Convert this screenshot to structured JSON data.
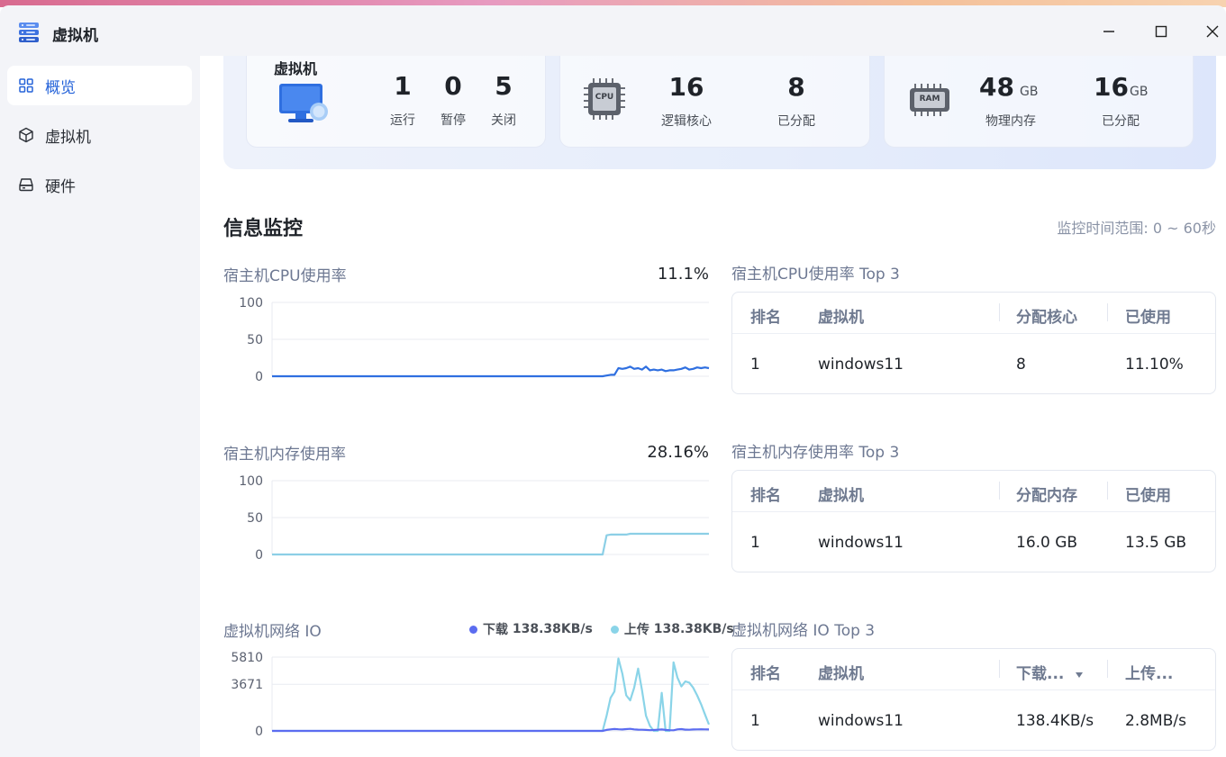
{
  "window": {
    "title": "虚拟机"
  },
  "sidebar": {
    "items": [
      {
        "label": "概览",
        "icon": "grid-icon",
        "active": true
      },
      {
        "label": "虚拟机",
        "icon": "cube-icon",
        "active": false
      },
      {
        "label": "硬件",
        "icon": "hard-drive-icon",
        "active": false
      }
    ]
  },
  "summary": {
    "vm_card": {
      "label": "虚拟机",
      "running": "1",
      "running_label": "运行",
      "paused": "0",
      "paused_label": "暂停",
      "stopped": "5",
      "stopped_label": "关闭"
    },
    "cpu_card": {
      "chip_text": "CPU",
      "logical_cores": "16",
      "logical_cores_label": "逻辑核心",
      "allocated": "8",
      "allocated_label": "已分配"
    },
    "ram_card": {
      "chip_text": "RAM",
      "physical": "48",
      "physical_unit": "GB",
      "physical_label": "物理内存",
      "allocated": "16",
      "allocated_unit": "GB",
      "allocated_label": "已分配"
    }
  },
  "monitor": {
    "title": "信息监控",
    "range": "监控时间范围: 0 ~ 60秒",
    "cpu": {
      "title": "宿主机CPU使用率",
      "value": "11.1%"
    },
    "mem": {
      "title": "宿主机内存使用率",
      "value": "28.16%"
    },
    "net": {
      "title": "虚拟机网络 IO",
      "download_label": "下载",
      "download_value": "138.38KB/s",
      "upload_label": "上传",
      "upload_value": "138.38KB/s"
    }
  },
  "tables": {
    "cpu_top": {
      "title": "宿主机CPU使用率 Top 3",
      "headers": [
        "排名",
        "虚拟机",
        "分配核心",
        "已使用"
      ],
      "rows": [
        [
          "1",
          "windows11",
          "8",
          "11.10%"
        ]
      ]
    },
    "mem_top": {
      "title": "宿主机内存使用率 Top 3",
      "headers": [
        "排名",
        "虚拟机",
        "分配内存",
        "已使用"
      ],
      "rows": [
        [
          "1",
          "windows11",
          "16.0 GB",
          "13.5 GB"
        ]
      ]
    },
    "net_top": {
      "title": "虚拟机网络 IO Top 3",
      "headers": [
        "排名",
        "虚拟机",
        "下载...",
        "上传..."
      ],
      "rows": [
        [
          "1",
          "windows11",
          "138.4KB/s",
          "2.8MB/s"
        ]
      ]
    }
  },
  "colors": {
    "accent": "#2563d9",
    "cpu_line": "#2f6fe0",
    "mem_line": "#8ccfe6",
    "download": "#5b6cf0",
    "upload": "#8ad4e8"
  },
  "chart_data": [
    {
      "type": "line",
      "title": "宿主机CPU使用率",
      "ylim": [
        0,
        100
      ],
      "yticks": [
        "0",
        "50",
        "100"
      ],
      "series": [
        {
          "values": [
            0,
            0,
            0,
            0,
            0,
            0,
            0,
            0,
            0,
            0,
            0,
            0,
            0,
            0,
            0,
            0,
            0,
            0,
            0,
            0,
            0,
            0,
            0,
            0,
            0,
            0,
            0,
            0,
            0,
            0,
            0,
            0,
            0,
            0,
            0,
            0,
            0,
            0,
            0,
            0,
            0,
            0,
            0,
            0,
            0,
            0,
            0,
            0,
            0,
            0,
            0,
            0,
            0,
            0,
            0,
            0,
            0,
            0,
            0,
            0,
            0,
            0,
            0,
            0,
            0,
            0,
            0,
            0,
            0,
            0,
            0,
            0,
            0,
            0,
            0,
            0,
            0,
            0,
            0,
            0,
            0,
            0,
            0,
            0,
            0,
            1,
            2,
            2,
            11,
            10,
            11,
            13,
            10,
            11,
            9,
            13,
            8,
            9,
            8,
            9,
            7,
            8,
            8,
            9,
            10,
            12,
            9,
            10,
            12,
            11,
            12,
            11
          ]
        }
      ],
      "grid": true
    },
    {
      "type": "line",
      "title": "宿主机内存使用率",
      "ylim": [
        0,
        100
      ],
      "yticks": [
        "0",
        "50",
        "100"
      ],
      "series": [
        {
          "values": [
            0,
            0,
            0,
            0,
            0,
            0,
            0,
            0,
            0,
            0,
            0,
            0,
            0,
            0,
            0,
            0,
            0,
            0,
            0,
            0,
            0,
            0,
            0,
            0,
            0,
            0,
            0,
            0,
            0,
            0,
            0,
            0,
            0,
            0,
            0,
            0,
            0,
            0,
            0,
            0,
            0,
            0,
            0,
            0,
            0,
            0,
            0,
            0,
            0,
            0,
            0,
            0,
            0,
            0,
            0,
            0,
            0,
            0,
            0,
            0,
            0,
            0,
            0,
            0,
            0,
            0,
            0,
            0,
            0,
            0,
            0,
            0,
            0,
            0,
            0,
            0,
            0,
            0,
            0,
            0,
            0,
            0,
            0,
            0,
            0,
            26,
            27,
            27,
            27,
            27,
            27,
            28,
            28,
            28,
            28,
            28,
            28,
            28,
            28,
            28,
            28,
            28,
            28,
            28,
            28,
            28,
            28,
            28,
            28,
            28,
            28,
            28
          ]
        }
      ],
      "grid": true
    },
    {
      "type": "line",
      "title": "虚拟机网络 IO",
      "ylim": [
        0,
        5810
      ],
      "yticks": [
        "0",
        "3671",
        "5810"
      ],
      "series": [
        {
          "name": "下载",
          "values": [
            0,
            0,
            0,
            0,
            0,
            0,
            0,
            0,
            0,
            0,
            0,
            0,
            0,
            0,
            0,
            0,
            0,
            0,
            0,
            0,
            0,
            0,
            0,
            0,
            0,
            0,
            0,
            0,
            0,
            0,
            0,
            0,
            0,
            0,
            0,
            0,
            0,
            0,
            0,
            0,
            0,
            0,
            0,
            0,
            0,
            0,
            0,
            0,
            0,
            0,
            0,
            0,
            0,
            0,
            0,
            0,
            0,
            0,
            0,
            0,
            0,
            0,
            0,
            0,
            0,
            0,
            0,
            0,
            0,
            0,
            0,
            0,
            0,
            0,
            0,
            0,
            0,
            0,
            0,
            0,
            0,
            0,
            0,
            0,
            0,
            80,
            120,
            150,
            130,
            110,
            140,
            160,
            120,
            100,
            90,
            80,
            60,
            70,
            90,
            110,
            80,
            60,
            50,
            120,
            140,
            100,
            90,
            110,
            120,
            130,
            120,
            110
          ]
        },
        {
          "name": "上传",
          "values": [
            0,
            0,
            0,
            0,
            0,
            0,
            0,
            0,
            0,
            0,
            0,
            0,
            0,
            0,
            0,
            0,
            0,
            0,
            0,
            0,
            0,
            0,
            0,
            0,
            0,
            0,
            0,
            0,
            0,
            0,
            0,
            0,
            0,
            0,
            0,
            0,
            0,
            0,
            0,
            0,
            0,
            0,
            0,
            0,
            0,
            0,
            0,
            0,
            0,
            0,
            0,
            0,
            0,
            0,
            0,
            0,
            0,
            0,
            0,
            0,
            0,
            0,
            0,
            0,
            0,
            0,
            0,
            0,
            0,
            0,
            0,
            0,
            0,
            0,
            0,
            0,
            0,
            0,
            0,
            0,
            0,
            0,
            0,
            0,
            0,
            1200,
            2600,
            3100,
            5700,
            4500,
            2800,
            2400,
            3400,
            4900,
            3200,
            1200,
            400,
            0,
            0,
            3000,
            0,
            0,
            5400,
            4200,
            3500,
            3900,
            3800,
            3400,
            2800,
            2100,
            1300,
            500
          ]
        }
      ],
      "grid": true
    }
  ]
}
